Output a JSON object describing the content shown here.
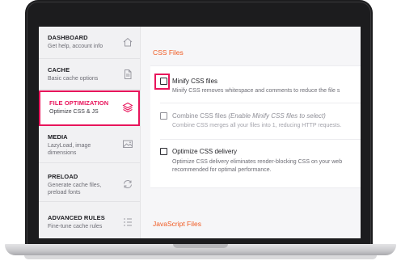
{
  "sidebar": {
    "items": [
      {
        "title": "DASHBOARD",
        "desc": "Get help, account info",
        "icon": "home-icon"
      },
      {
        "title": "CACHE",
        "desc": "Basic cache options",
        "icon": "document-icon"
      },
      {
        "title": "FILE OPTIMIZATION",
        "desc": "Optimize CSS & JS",
        "icon": "layers-icon",
        "active": true
      },
      {
        "title": "MEDIA",
        "desc": "LazyLoad, image dimensions",
        "icon": "image-icon"
      },
      {
        "title": "PRELOAD",
        "desc": "Generate cache files, preload fonts",
        "icon": "refresh-icon"
      },
      {
        "title": "ADVANCED RULES",
        "desc": "Fine-tune cache rules",
        "icon": "list-icon"
      }
    ]
  },
  "main": {
    "css_title": "CSS Files",
    "js_title": "JavaScript Files",
    "options": [
      {
        "label": "Minify CSS files",
        "desc": "Minify CSS removes whitespace and comments to reduce the file s",
        "checked": false,
        "highlighted": true
      },
      {
        "label": "Combine CSS files ",
        "label_note": "(Enable Minify CSS files to select)",
        "desc": "Combine CSS merges all your files into 1, reducing HTTP requests.",
        "checked": false,
        "disabled": true
      },
      {
        "label": "Optimize CSS delivery",
        "desc_lines": [
          "Optimize CSS delivery eliminates render-blocking CSS on your web",
          "recommended for optimal performance."
        ],
        "checked": false
      }
    ]
  },
  "colors": {
    "accent": "#e8145b",
    "section_title": "#f05a22"
  }
}
